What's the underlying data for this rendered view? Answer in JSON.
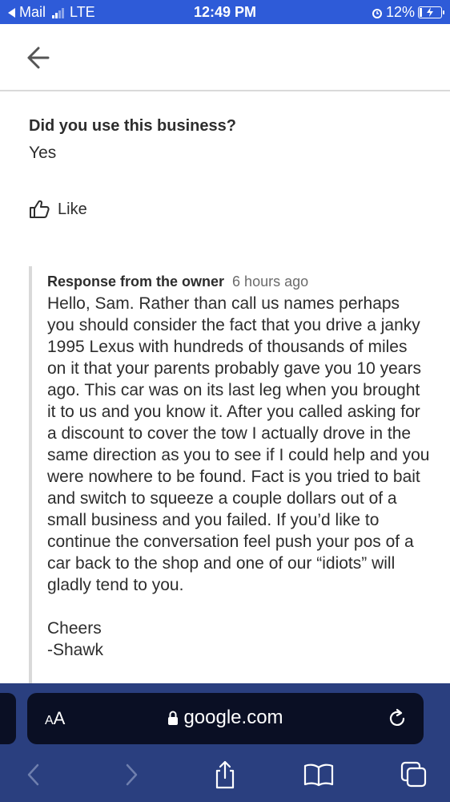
{
  "status_bar": {
    "back_app": "Mail",
    "network": "LTE",
    "time": "12:49 PM",
    "battery": "12%",
    "battery_level": 0.12
  },
  "review": {
    "question": "Did you use this business?",
    "answer": "Yes",
    "like_label": "Like"
  },
  "owner_response": {
    "label": "Response from the owner",
    "time": "6 hours ago",
    "body": "Hello, Sam. Rather than call us names perhaps you should consider the fact that you drive a janky 1995 Lexus with hundreds of thousands of miles on it that your parents probably gave you 10 years ago. This car was on its last leg when you brought it to us and you know it. After you called asking for a discount to cover the tow I actually drove in the same direction as you to see if I could help and you were nowhere to be found. Fact is you tried to bait and switch to squeeze a couple dollars out of a small business and you failed. If you’d like to continue the conversation feel push your pos of a car back to the shop and one of our “idiots” will gladly tend to you.",
    "sign_off": "Cheers",
    "signature": "-Shawk"
  },
  "browser": {
    "aa_big": "A",
    "aa_small": "A",
    "url": "google.com"
  },
  "colors": {
    "status_bar": "#2e5bd8",
    "browser_chrome": "#2a3f7f",
    "address_bar": "#0a0f24"
  }
}
